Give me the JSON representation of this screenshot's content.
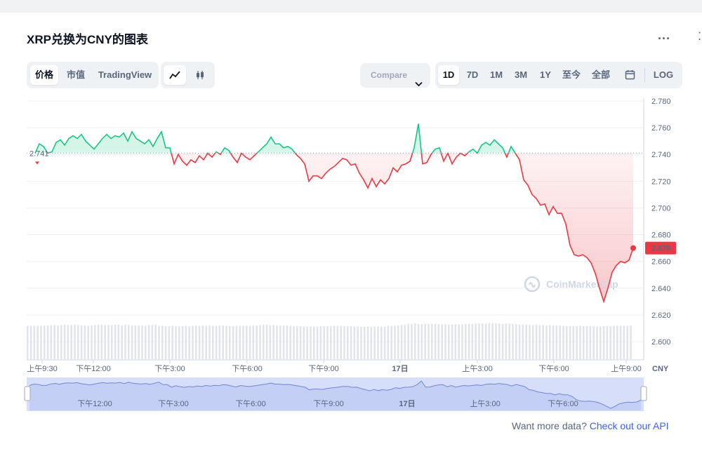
{
  "header": {
    "title": "XRP兑换为CNY的图表",
    "more_label": "..."
  },
  "toolbar": {
    "metric_tabs": [
      "价格",
      "市值",
      "TradingView"
    ],
    "chart_type_icons": [
      "line-chart-icon",
      "candlestick-icon"
    ],
    "compare_label": "Compare",
    "ranges": [
      "1D",
      "7D",
      "1M",
      "3M",
      "1Y",
      "至今",
      "全部"
    ],
    "calendar_icon": "calendar-icon",
    "log_label": "LOG",
    "active_metric": "价格",
    "active_range": "1D"
  },
  "colors": {
    "up": "#16c784",
    "down": "#ea3943",
    "navigator": "#d7def9",
    "brand": "#3861fb"
  },
  "chart_data": {
    "type": "line",
    "currency": "CNY",
    "ylim": [
      2.595,
      2.785
    ],
    "y_ticks": [
      "2.780",
      "2.760",
      "2.740",
      "2.720",
      "2.700",
      "2.680",
      "2.660",
      "2.640",
      "2.620",
      "2.600"
    ],
    "x_tick_labels": [
      "上午9:30",
      "下午12:00",
      "下午3:00",
      "下午6:00",
      "下午9:00",
      "17日",
      "上午3:00",
      "下午6:00",
      "上午9:00"
    ],
    "navigator_tick_labels": [
      "下午12:00",
      "下午3:00",
      "下午6:00",
      "下午9:00",
      "17日",
      "上午3:00",
      "下午6:00"
    ],
    "baseline": 2.741,
    "baseline_label": "2.741",
    "current_value": 2.67,
    "current_label": "2.670",
    "series": [
      {
        "values": [
          2.741,
          2.748,
          2.746,
          2.741,
          2.742,
          2.749,
          2.751,
          2.747,
          2.752,
          2.754,
          2.752,
          2.755,
          2.75,
          2.747,
          2.744,
          2.748,
          2.752,
          2.755,
          2.752,
          2.754,
          2.753,
          2.756,
          2.75,
          2.757,
          2.752,
          2.75,
          2.748,
          2.751,
          2.746,
          2.752,
          2.757,
          2.745,
          2.745,
          2.733,
          2.74,
          2.735,
          2.732,
          2.736,
          2.734,
          2.739,
          2.736,
          2.741,
          2.738,
          2.742,
          2.74,
          2.745,
          2.743,
          2.738,
          2.734,
          2.741,
          2.738,
          2.736,
          2.739,
          2.742,
          2.745,
          2.748,
          2.753,
          2.748,
          2.748,
          2.745,
          2.746,
          2.744,
          2.74,
          2.737,
          2.733,
          2.72,
          2.724,
          2.724,
          2.722,
          2.726,
          2.729,
          2.731,
          2.734,
          2.737,
          2.736,
          2.732,
          2.733,
          2.726,
          2.721,
          2.715,
          2.722,
          2.716,
          2.721,
          2.718,
          2.722,
          2.73,
          2.727,
          2.732,
          2.733,
          2.735,
          2.745,
          2.763,
          2.733,
          2.734,
          2.74,
          2.744,
          2.745,
          2.735,
          2.741,
          2.733,
          2.738,
          2.741,
          2.739,
          2.742,
          2.744,
          2.741,
          2.747,
          2.749,
          2.747,
          2.751,
          2.748,
          2.745,
          2.738,
          2.746,
          2.741,
          2.736,
          2.721,
          2.717,
          2.71,
          2.707,
          2.702,
          2.703,
          2.695,
          2.701,
          2.696,
          2.696,
          2.688,
          2.672,
          2.665,
          2.664,
          2.665,
          2.663,
          2.659,
          2.651,
          2.64,
          2.63,
          2.64,
          2.652,
          2.657,
          2.66,
          2.659,
          2.661,
          2.67
        ]
      }
    ],
    "volume_relative": [
      0.9,
      0.9,
      0.9,
      0.9,
      0.9,
      0.91,
      0.92,
      0.91,
      0.92,
      0.93,
      0.92,
      0.93,
      0.92,
      0.91,
      0.9,
      0.91,
      0.92,
      0.93,
      0.92,
      0.92,
      0.92,
      0.93,
      0.91,
      0.93,
      0.92,
      0.91,
      0.91,
      0.91,
      0.9,
      0.92,
      0.93,
      0.9,
      0.9,
      0.89,
      0.9,
      0.89,
      0.89,
      0.9,
      0.89,
      0.9,
      0.9,
      0.91,
      0.9,
      0.91,
      0.9,
      0.91,
      0.91,
      0.9,
      0.89,
      0.9,
      0.9,
      0.9,
      0.9,
      0.91,
      0.91,
      0.92,
      0.93,
      0.92,
      0.92,
      0.91,
      0.91,
      0.91,
      0.9,
      0.89,
      0.89,
      0.88,
      0.88,
      0.88,
      0.88,
      0.89,
      0.89,
      0.89,
      0.9,
      0.9,
      0.9,
      0.89,
      0.89,
      0.88,
      0.88,
      0.87,
      0.88,
      0.87,
      0.88,
      0.88,
      0.88,
      0.9,
      0.9,
      0.91,
      0.92,
      0.93,
      0.95,
      0.97,
      0.94,
      0.94,
      0.95,
      0.95,
      0.95,
      0.94,
      0.94,
      0.93,
      0.94,
      0.94,
      0.94,
      0.95,
      0.95,
      0.95,
      0.96,
      0.96,
      0.96,
      0.97,
      0.96,
      0.96,
      0.95,
      0.96,
      0.95,
      0.94,
      0.93,
      0.93,
      0.92,
      0.92,
      0.92,
      0.92,
      0.91,
      0.92,
      0.91,
      0.91,
      0.9,
      0.89,
      0.89,
      0.89,
      0.9,
      0.89,
      0.89,
      0.89,
      0.88,
      0.88,
      0.89,
      0.89,
      0.9,
      0.9,
      0.9,
      0.9,
      0.91
    ],
    "watermark": "CoinMarketCap"
  },
  "footer": {
    "text": "Want more data?",
    "link": "Check out our API"
  }
}
